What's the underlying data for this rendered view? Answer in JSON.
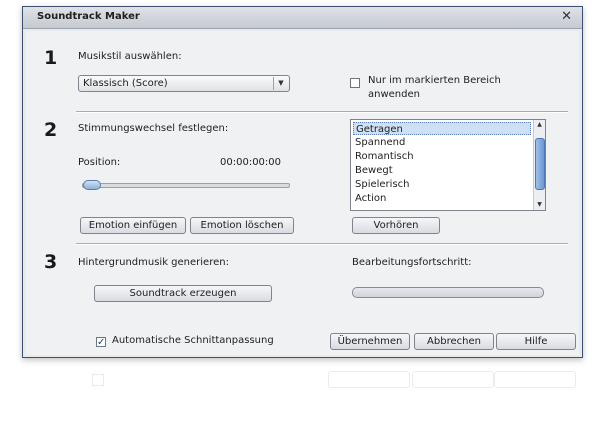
{
  "window": {
    "title": "Soundtrack Maker",
    "close_glyph": "✕"
  },
  "section1": {
    "number": "1",
    "label": "Musikstil auswählen:",
    "style_select": {
      "value": "Klassisch (Score)"
    },
    "only_marked": {
      "label_line1": "Nur im markierten Bereich",
      "label_line2": "anwenden",
      "checked": false
    }
  },
  "section2": {
    "number": "2",
    "label": "Stimmungswechsel festlegen:",
    "position_label": "Position:",
    "position_time": "00:00:00:00",
    "slider_position": 0.05,
    "emotions": {
      "items": [
        "Getragen",
        "Spannend",
        "Romantisch",
        "Bewegt",
        "Spielerisch",
        "Action"
      ],
      "selected_index": 0
    },
    "buttons": {
      "insert": "Emotion einfügen",
      "delete": "Emotion löschen",
      "preview": "Vorhören"
    }
  },
  "section3": {
    "number": "3",
    "label": "Hintergrundmusik generieren:",
    "generate_button": "Soundtrack erzeugen",
    "progress_label": "Bearbeitungsfortschritt:",
    "progress": 0.0
  },
  "footer": {
    "auto_cut": {
      "label": "Automatische Schnittanpassung",
      "checked": true
    },
    "buttons": {
      "apply": "Übernehmen",
      "cancel": "Abbrechen",
      "help": "Hilfe"
    }
  },
  "colors": {
    "accent": "#3d4f72",
    "selection": "#cfe0f5",
    "check": "#1a3d8a"
  }
}
